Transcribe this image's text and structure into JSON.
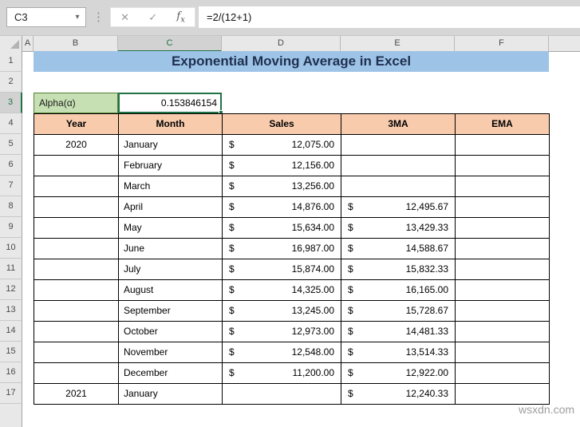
{
  "formula_bar": {
    "name_box_value": "C3",
    "name_box_dropdown_icon": "▾",
    "separator_dots_icon": "⋮",
    "cancel_icon": "✕",
    "enter_icon": "✓",
    "fx_icon_f": "f",
    "fx_icon_x": "x",
    "formula": "=2/(12+1)"
  },
  "sheet": {
    "column_headers": [
      "A",
      "B",
      "C",
      "D",
      "E",
      "F"
    ],
    "row_headers": [
      "1",
      "2",
      "3",
      "4",
      "5",
      "6",
      "7",
      "8",
      "9",
      "10",
      "11",
      "12",
      "13",
      "14",
      "15",
      "16",
      "17"
    ],
    "selection": {
      "column": "C",
      "row": "3",
      "active_cell": "C3"
    },
    "title": "Exponential Moving Average in Excel",
    "alpha_label": "Alpha(α)",
    "alpha_value": "0.153846154",
    "table": {
      "headers": [
        "Year",
        "Month",
        "Sales",
        "3MA",
        "EMA"
      ],
      "currency_symbol": "$",
      "rows": [
        {
          "year": "2020",
          "month": "January",
          "sales": "12,075.00",
          "ma3": "",
          "ema": ""
        },
        {
          "year": "",
          "month": "February",
          "sales": "12,156.00",
          "ma3": "",
          "ema": ""
        },
        {
          "year": "",
          "month": "March",
          "sales": "13,256.00",
          "ma3": "",
          "ema": ""
        },
        {
          "year": "",
          "month": "April",
          "sales": "14,876.00",
          "ma3": "12,495.67",
          "ema": ""
        },
        {
          "year": "",
          "month": "May",
          "sales": "15,634.00",
          "ma3": "13,429.33",
          "ema": ""
        },
        {
          "year": "",
          "month": "June",
          "sales": "16,987.00",
          "ma3": "14,588.67",
          "ema": ""
        },
        {
          "year": "",
          "month": "July",
          "sales": "15,874.00",
          "ma3": "15,832.33",
          "ema": ""
        },
        {
          "year": "",
          "month": "August",
          "sales": "14,325.00",
          "ma3": "16,165.00",
          "ema": ""
        },
        {
          "year": "",
          "month": "September",
          "sales": "13,245.00",
          "ma3": "15,728.67",
          "ema": ""
        },
        {
          "year": "",
          "month": "October",
          "sales": "12,973.00",
          "ma3": "14,481.33",
          "ema": ""
        },
        {
          "year": "",
          "month": "November",
          "sales": "12,548.00",
          "ma3": "13,514.33",
          "ema": ""
        },
        {
          "year": "",
          "month": "December",
          "sales": "11,200.00",
          "ma3": "12,922.00",
          "ema": ""
        },
        {
          "year": "2021",
          "month": "January",
          "sales": "",
          "ma3": "12,240.33",
          "ema": ""
        }
      ]
    },
    "watermark": "wsxdn.com"
  },
  "colors": {
    "title_fill": "#9DC3E6",
    "title_text": "#1F3050",
    "alpha_fill": "#C6E0B4",
    "alpha_border": "#538135",
    "header_fill": "#F8CBAD",
    "selection_green": "#217346",
    "chrome_gray": "#D6D6D6",
    "header_gray": "#E8E8E8",
    "selected_header_gray": "#D2D2D2"
  }
}
